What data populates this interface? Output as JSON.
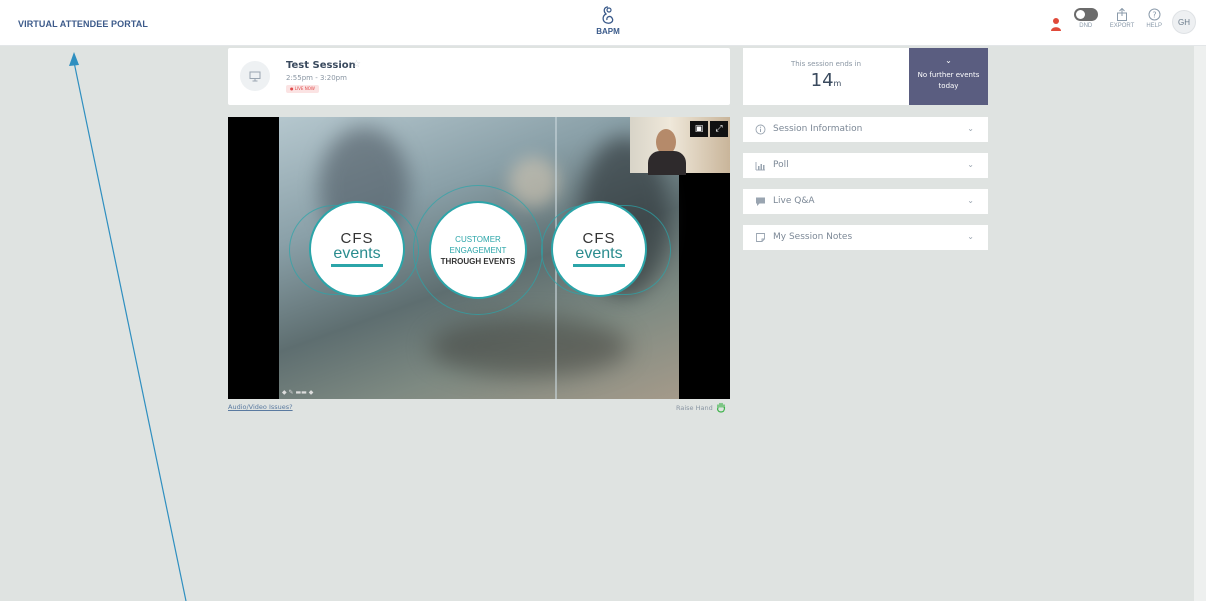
{
  "header": {
    "portal_title": "VIRTUAL ATTENDEE PORTAL",
    "brand": "BAPM",
    "dnd_label": "DND",
    "export_label": "EXPORT",
    "help_label": "HELP",
    "avatar_initials": "GH"
  },
  "session": {
    "title": "Test Session",
    "time": "2:55pm - 3:20pm",
    "live_badge": "● LIVE NOW"
  },
  "countdown": {
    "label": "This session ends in",
    "value": "14",
    "unit": "m"
  },
  "next_events": {
    "text": "No further events today"
  },
  "accordion": [
    {
      "label": "Session Information",
      "icon": "info-icon"
    },
    {
      "label": "Poll",
      "icon": "bar-chart-icon"
    },
    {
      "label": "Live Q&A",
      "icon": "chat-bubble-icon"
    },
    {
      "label": "My Session Notes",
      "icon": "notes-icon"
    }
  ],
  "video": {
    "left_logo_top": "CFS",
    "left_logo_bottom": "events",
    "center_line1": "CUSTOMER",
    "center_line2": "ENGAGEMENT",
    "center_line3": "THROUGH EVENTS",
    "right_logo_top": "CFS",
    "right_logo_bottom": "events"
  },
  "footer": {
    "av_issues": "Audio/Video Issues?",
    "raise_hand": "Raise Hand"
  },
  "colors": {
    "brand_blue": "#3c5a8a",
    "accent_teal": "#2ba5a9",
    "panel_purple": "#5a5d80",
    "page_bg": "#dfe3e1",
    "annotation_arrow": "#2f8fc0"
  }
}
